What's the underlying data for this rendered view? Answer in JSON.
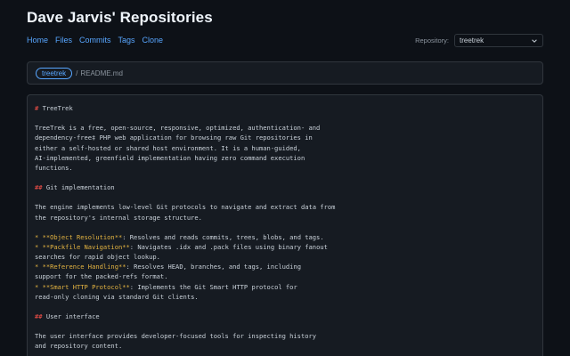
{
  "header": {
    "title": "Dave Jarvis' Repositories"
  },
  "nav": {
    "items": [
      "Home",
      "Files",
      "Commits",
      "Tags",
      "Clone"
    ]
  },
  "repo_selector": {
    "label": "Repository:",
    "selected": "treetrek"
  },
  "breadcrumb": {
    "repo": "treetrek",
    "separator": "/",
    "file": "README.md"
  },
  "readme": {
    "lines": [
      {
        "kind": "h1",
        "mark": "#",
        "text": "TreeTrek"
      },
      {
        "kind": "blank"
      },
      {
        "kind": "text",
        "text": "TreeTrek is a free, open-source, responsive, optimized, authentication- and"
      },
      {
        "kind": "text",
        "text": "dependency-free‡ PHP web application for browsing raw Git repositories in"
      },
      {
        "kind": "text",
        "text": "either a self-hosted or shared host environment. It is a human-guided,"
      },
      {
        "kind": "text",
        "text": "AI-implemented, greenfield implementation having zero command execution"
      },
      {
        "kind": "text",
        "text": "functions."
      },
      {
        "kind": "blank"
      },
      {
        "kind": "h2",
        "mark": "##",
        "text": "Git implementation"
      },
      {
        "kind": "blank"
      },
      {
        "kind": "text",
        "text": "The engine implements low-level Git protocols to navigate and extract data from"
      },
      {
        "kind": "text",
        "text": "the repository's internal storage structure."
      },
      {
        "kind": "blank"
      },
      {
        "kind": "li",
        "mark": "*",
        "strong": "**Object Resolution**",
        "text": ": Resolves and reads commits, trees, blobs, and tags."
      },
      {
        "kind": "li",
        "mark": "*",
        "strong": "**Packfile Navigation**",
        "text": ": Navigates .idx and .pack files using binary fanout"
      },
      {
        "kind": "text",
        "text": "searches for rapid object lookup."
      },
      {
        "kind": "li",
        "mark": "*",
        "strong": "**Reference Handling**",
        "text": ": Resolves HEAD, branches, and tags, including"
      },
      {
        "kind": "text",
        "text": "support for the packed-refs format."
      },
      {
        "kind": "li",
        "mark": "*",
        "strong": "**Smart HTTP Protocol**",
        "text": ": Implements the Git Smart HTTP protocol for"
      },
      {
        "kind": "text",
        "text": "read-only cloning via standard Git clients."
      },
      {
        "kind": "blank"
      },
      {
        "kind": "h2",
        "mark": "##",
        "text": "User interface"
      },
      {
        "kind": "blank"
      },
      {
        "kind": "text",
        "text": "The user interface provides developer-focused tools for inspecting history"
      },
      {
        "kind": "text",
        "text": "and repository content."
      }
    ]
  },
  "colors": {
    "background": "#0d1117",
    "panel": "#161b22",
    "border": "#30363d",
    "link": "#58a6ff",
    "heading_marker": "#f85149",
    "emphasis": "#e3b341"
  }
}
